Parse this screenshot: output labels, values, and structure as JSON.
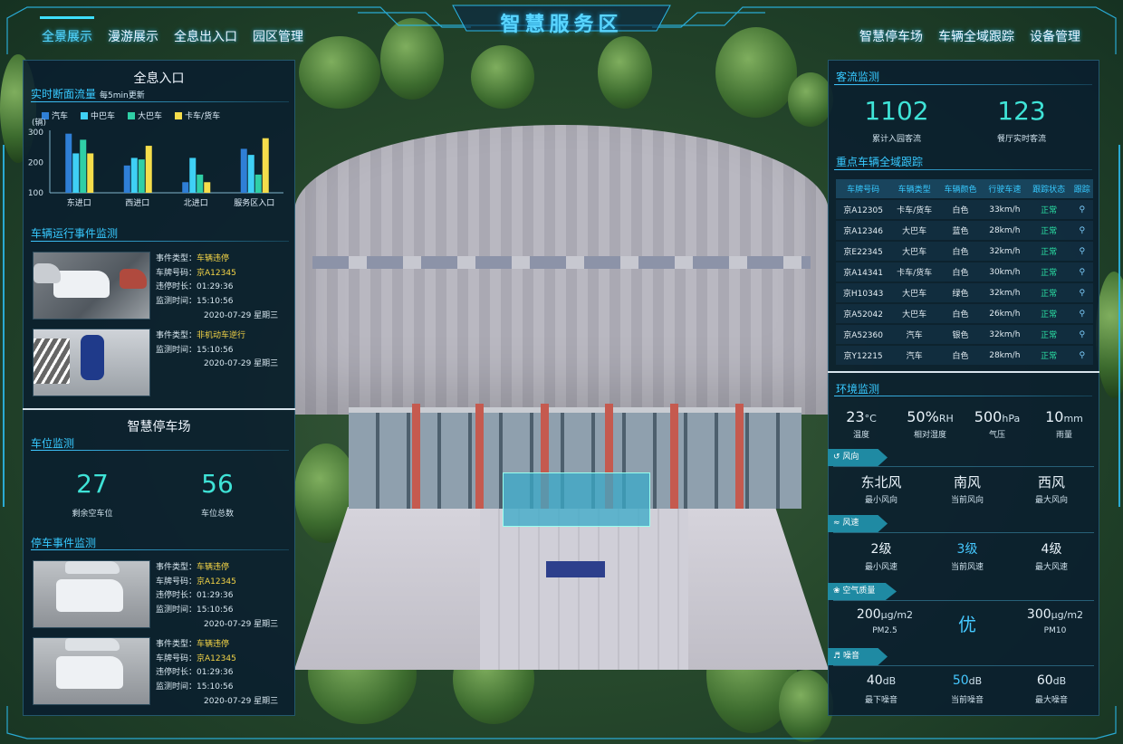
{
  "title": "智慧服务区",
  "nav_left": [
    "全景展示",
    "漫游展示",
    "全息出入口",
    "园区管理"
  ],
  "nav_right": [
    "智慧停车场",
    "车辆全域跟踪",
    "设备管理"
  ],
  "left": {
    "entrance_title": "全息入口",
    "flow_title": "实时断面流量",
    "flow_note": "每5min更新",
    "unit_label": "(辆)",
    "event_title": "车辆运行事件监测",
    "events": [
      {
        "lines": [
          [
            "事件类型：",
            "车辆违停"
          ],
          [
            "车牌号码：",
            "京A12345"
          ],
          [
            "违停时长：",
            "01:29:36"
          ],
          [
            "监测时间：",
            "15:10:56"
          ]
        ],
        "date": "2020-07-29 星期三"
      },
      {
        "lines": [
          [
            "事件类型：",
            "非机动车逆行"
          ],
          [
            "监测时间：",
            "15:10:56"
          ]
        ],
        "date": "2020-07-29 星期三"
      }
    ],
    "parking_title": "智慧停车场",
    "spot_title": "车位监测",
    "spots_free": "27",
    "spots_free_label": "剩余空车位",
    "spots_total": "56",
    "spots_total_label": "车位总数",
    "park_event_title": "停车事件监测",
    "park_events": [
      {
        "lines": [
          [
            "事件类型：",
            "车辆违停"
          ],
          [
            "车牌号码：",
            "京A12345"
          ],
          [
            "违停时长：",
            "01:29:36"
          ],
          [
            "监测时间：",
            "15:10:56"
          ]
        ],
        "date": "2020-07-29 星期三"
      },
      {
        "lines": [
          [
            "事件类型：",
            "车辆违停"
          ],
          [
            "车牌号码：",
            "京A12345"
          ],
          [
            "违停时长：",
            "01:29:36"
          ],
          [
            "监测时间：",
            "15:10:56"
          ]
        ],
        "date": "2020-07-29 星期三"
      }
    ]
  },
  "chart_data": {
    "type": "bar",
    "categories": [
      "东进口",
      "西进口",
      "北进口",
      "服务区入口"
    ],
    "series": [
      {
        "name": "汽车",
        "color": "#2f7fd6",
        "values": [
          295,
          190,
          135,
          245
        ]
      },
      {
        "name": "中巴车",
        "color": "#3fd0f5",
        "values": [
          230,
          215,
          215,
          225
        ]
      },
      {
        "name": "大巴车",
        "color": "#2fcfa6",
        "values": [
          275,
          210,
          160,
          160
        ]
      },
      {
        "name": "卡车/货车",
        "color": "#f5dd4b",
        "values": [
          230,
          255,
          135,
          280
        ]
      }
    ],
    "yticks": [
      100,
      200,
      300
    ],
    "ylim": [
      100,
      300
    ],
    "ylabel": "(辆)"
  },
  "right": {
    "visitor_title": "客流监测",
    "total_visitors": "1102",
    "total_label": "累计入园客流",
    "restaurant": "123",
    "restaurant_label": "餐厅实时客流",
    "track_title": "重点车辆全域跟踪",
    "table_headers": [
      "车牌号码",
      "车辆类型",
      "车辆颜色",
      "行驶车速",
      "跟踪状态",
      "跟踪"
    ],
    "rows": [
      [
        "京A12305",
        "卡车/货车",
        "白色",
        "33km/h",
        "正常"
      ],
      [
        "京A12346",
        "大巴车",
        "蓝色",
        "28km/h",
        "正常"
      ],
      [
        "京E22345",
        "大巴车",
        "白色",
        "32km/h",
        "正常"
      ],
      [
        "京A14341",
        "卡车/货车",
        "白色",
        "30km/h",
        "正常"
      ],
      [
        "京H10343",
        "大巴车",
        "绿色",
        "32km/h",
        "正常"
      ],
      [
        "京A52042",
        "大巴车",
        "白色",
        "26km/h",
        "正常"
      ],
      [
        "京A52360",
        "汽车",
        "银色",
        "32km/h",
        "正常"
      ],
      [
        "京Y12215",
        "汽车",
        "白色",
        "28km/h",
        "正常"
      ]
    ],
    "env_title": "环境监测",
    "env": [
      {
        "v": "23",
        "u": "°C",
        "l": "温度"
      },
      {
        "v": "50%",
        "u": "RH",
        "l": "相对湿度"
      },
      {
        "v": "500",
        "u": "hPa",
        "l": "气压"
      },
      {
        "v": "10",
        "u": "mm",
        "l": "雨量"
      }
    ],
    "wind_dir_tag": "风向",
    "wind_dir": [
      {
        "v": "东北风",
        "l": "最小风向"
      },
      {
        "v": "南风",
        "l": "当前风向"
      },
      {
        "v": "西风",
        "l": "最大风向"
      }
    ],
    "wind_speed_tag": "风速",
    "wind_speed": [
      {
        "v": "2级",
        "l": "最小风速"
      },
      {
        "v": "3级",
        "l": "当前风速"
      },
      {
        "v": "4级",
        "l": "最大风速"
      }
    ],
    "air_tag": "空气质量",
    "pm25": "200",
    "pm_unit": "μg/m2",
    "pm25_label": "PM2.5",
    "air_quality": "优",
    "pm10": "300",
    "pm10_label": "PM10",
    "noise_tag": "噪音",
    "noise": [
      {
        "v": "40",
        "u": "dB",
        "l": "最下噪音"
      },
      {
        "v": "50",
        "u": "dB",
        "l": "当前噪音"
      },
      {
        "v": "60",
        "u": "dB",
        "l": "最大噪音"
      }
    ]
  }
}
